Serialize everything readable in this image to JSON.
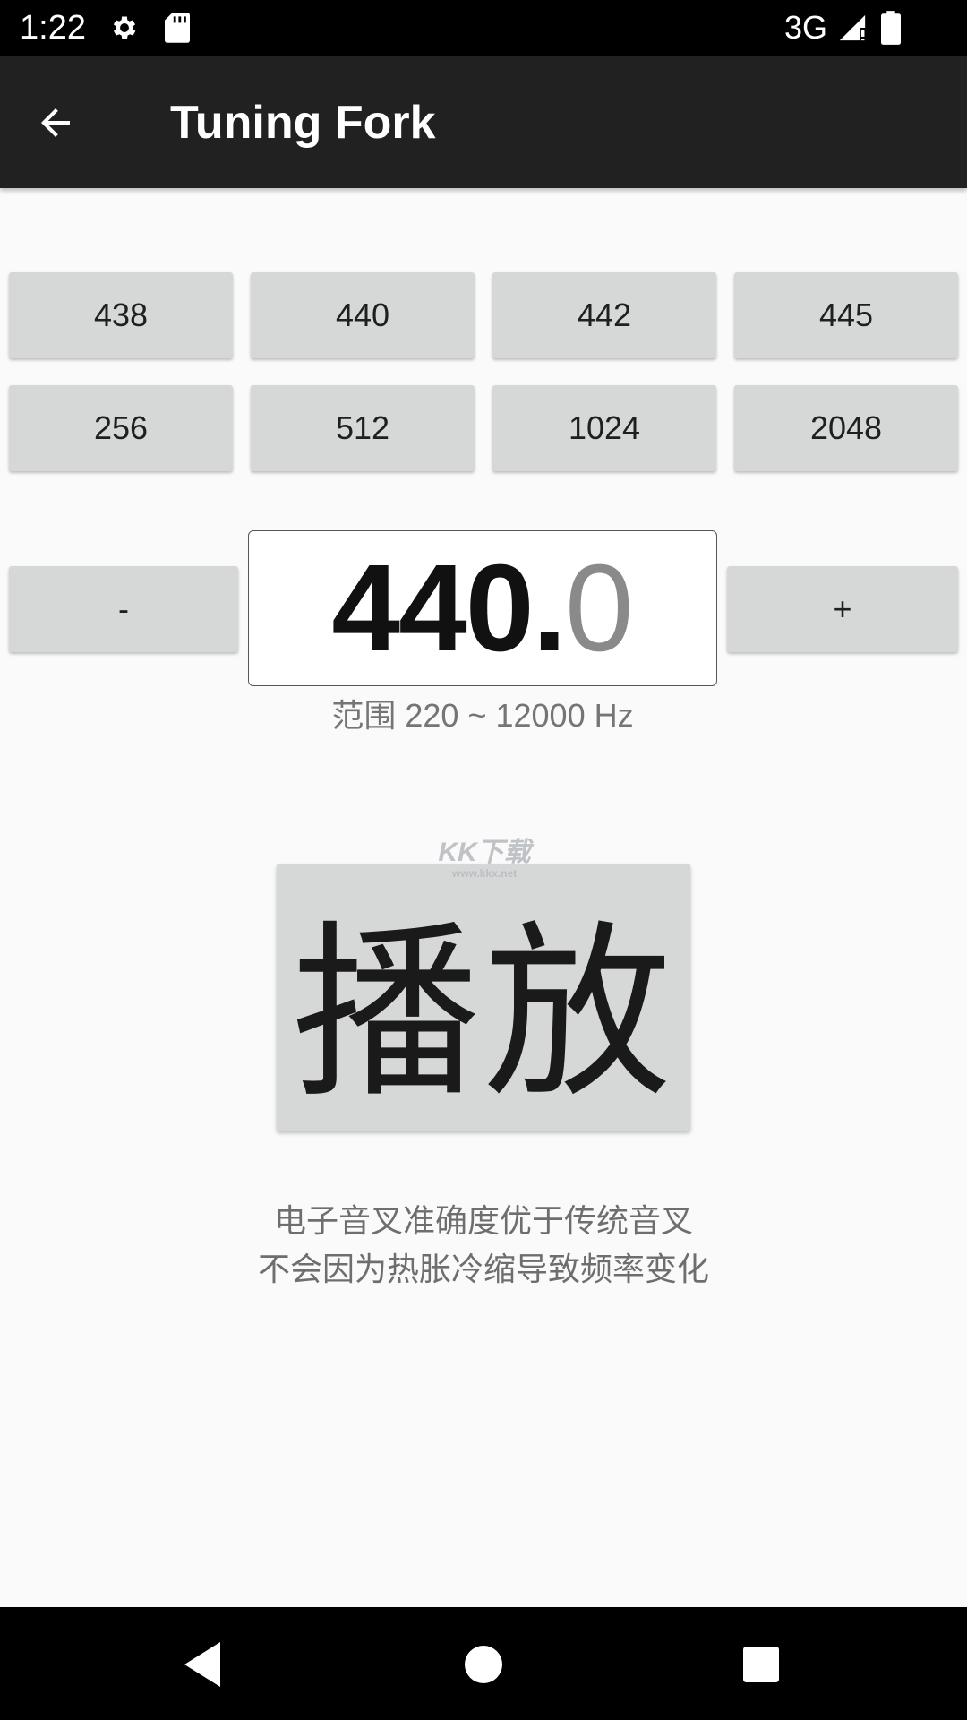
{
  "status_bar": {
    "time": "1:22",
    "network": "3G",
    "icons": [
      "settings-icon",
      "sd-card-icon",
      "signal-icon",
      "battery-icon"
    ]
  },
  "app_bar": {
    "title": "Tuning Fork",
    "back_icon": "arrow-back-icon"
  },
  "presets": {
    "row1": [
      "438",
      "440",
      "442",
      "445"
    ],
    "row2": [
      "256",
      "512",
      "1024",
      "2048"
    ]
  },
  "frequency": {
    "decrease_label": "-",
    "increase_label": "+",
    "integer_part": "440.",
    "decimal_part": "0",
    "range_text": "范围 220 ~ 12000 Hz"
  },
  "play": {
    "label": "播放"
  },
  "watermark": {
    "logo": "KK下载",
    "url": "www.kkx.net"
  },
  "description": {
    "line1": "电子音叉准确度优于传统音叉",
    "line2": "不会因为热胀冷缩导致频率变化"
  },
  "nav_bar": {
    "icons": [
      "back-triangle-icon",
      "home-circle-icon",
      "recents-square-icon"
    ]
  },
  "colors": {
    "status_bar": "#000000",
    "app_bar": "#212121",
    "background": "#fafafa",
    "button": "#d6d7d7",
    "decimal_text": "#8a8a8a"
  }
}
